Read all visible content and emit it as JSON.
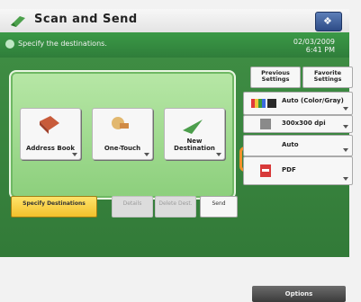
{
  "header": {
    "title": "Scan and Send",
    "icon": "scanner-icon"
  },
  "status": {
    "message": "Specify the destinations.",
    "date": "02/03/2009",
    "time": "6:41 PM"
  },
  "destination_buttons": [
    {
      "label": "Address Book",
      "icon": "address-book-icon"
    },
    {
      "label": "One-Touch",
      "icon": "one-touch-icon"
    },
    {
      "label": "New Destination",
      "icon": "new-destination-icon"
    }
  ],
  "tabs": {
    "specify": "Specify Destinations",
    "details": "Details",
    "delete": "Delete Dest.",
    "send": "Send"
  },
  "right_panel": {
    "previous_settings": "Previous Settings",
    "favorite_settings": "Favorite Settings",
    "color_mode": "Auto (Color/Gray)",
    "resolution": "300x300 dpi",
    "auto": "Auto",
    "file_format": "PDF"
  },
  "options_label": "Options",
  "colors": {
    "highlight": "#f2912b",
    "status_bar": "#3b9a47",
    "selected_tab": "#f2c12b"
  }
}
